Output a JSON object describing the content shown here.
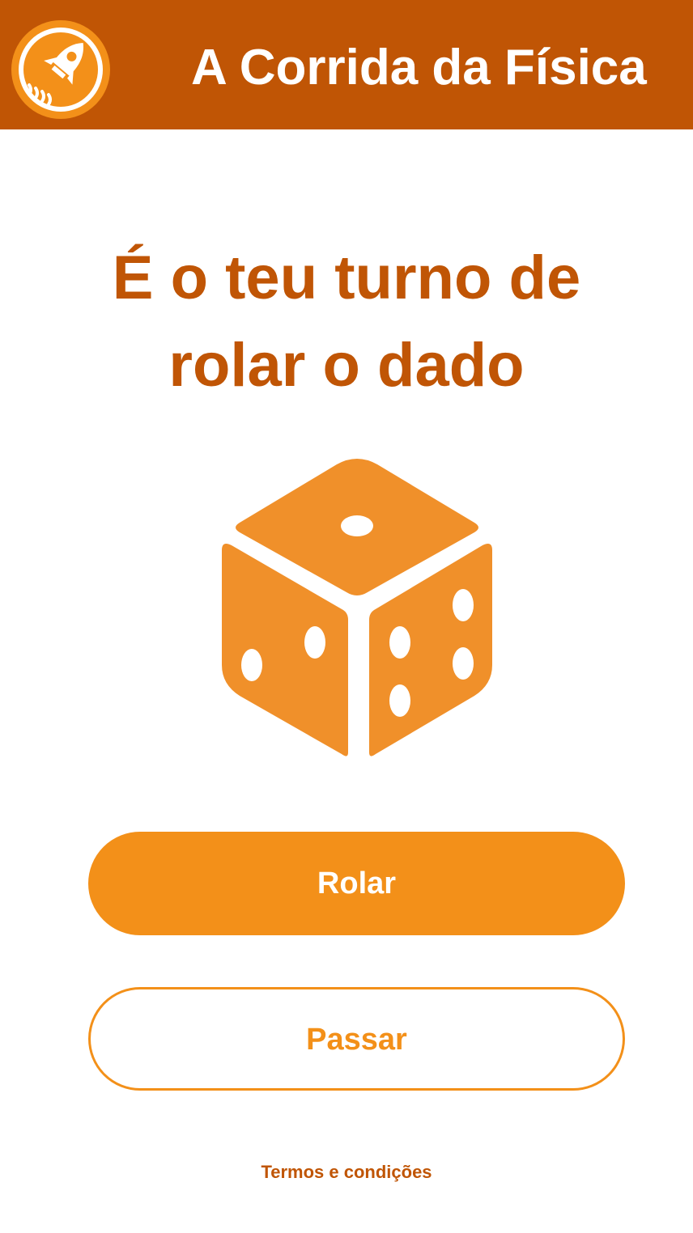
{
  "header": {
    "logo_icon": "rocket-icon",
    "title": "A Corrida da Física",
    "background_color": "#c05505"
  },
  "main": {
    "heading_line1": "É o teu turno de",
    "heading_line2": "rolar o dado",
    "dice_icon": "dice-icon",
    "dice_color": "#f0902a"
  },
  "actions": {
    "roll_label": "Rolar",
    "pass_label": "Passar",
    "accent_color": "#f39019"
  },
  "footer": {
    "terms_label": "Termos e condições"
  }
}
